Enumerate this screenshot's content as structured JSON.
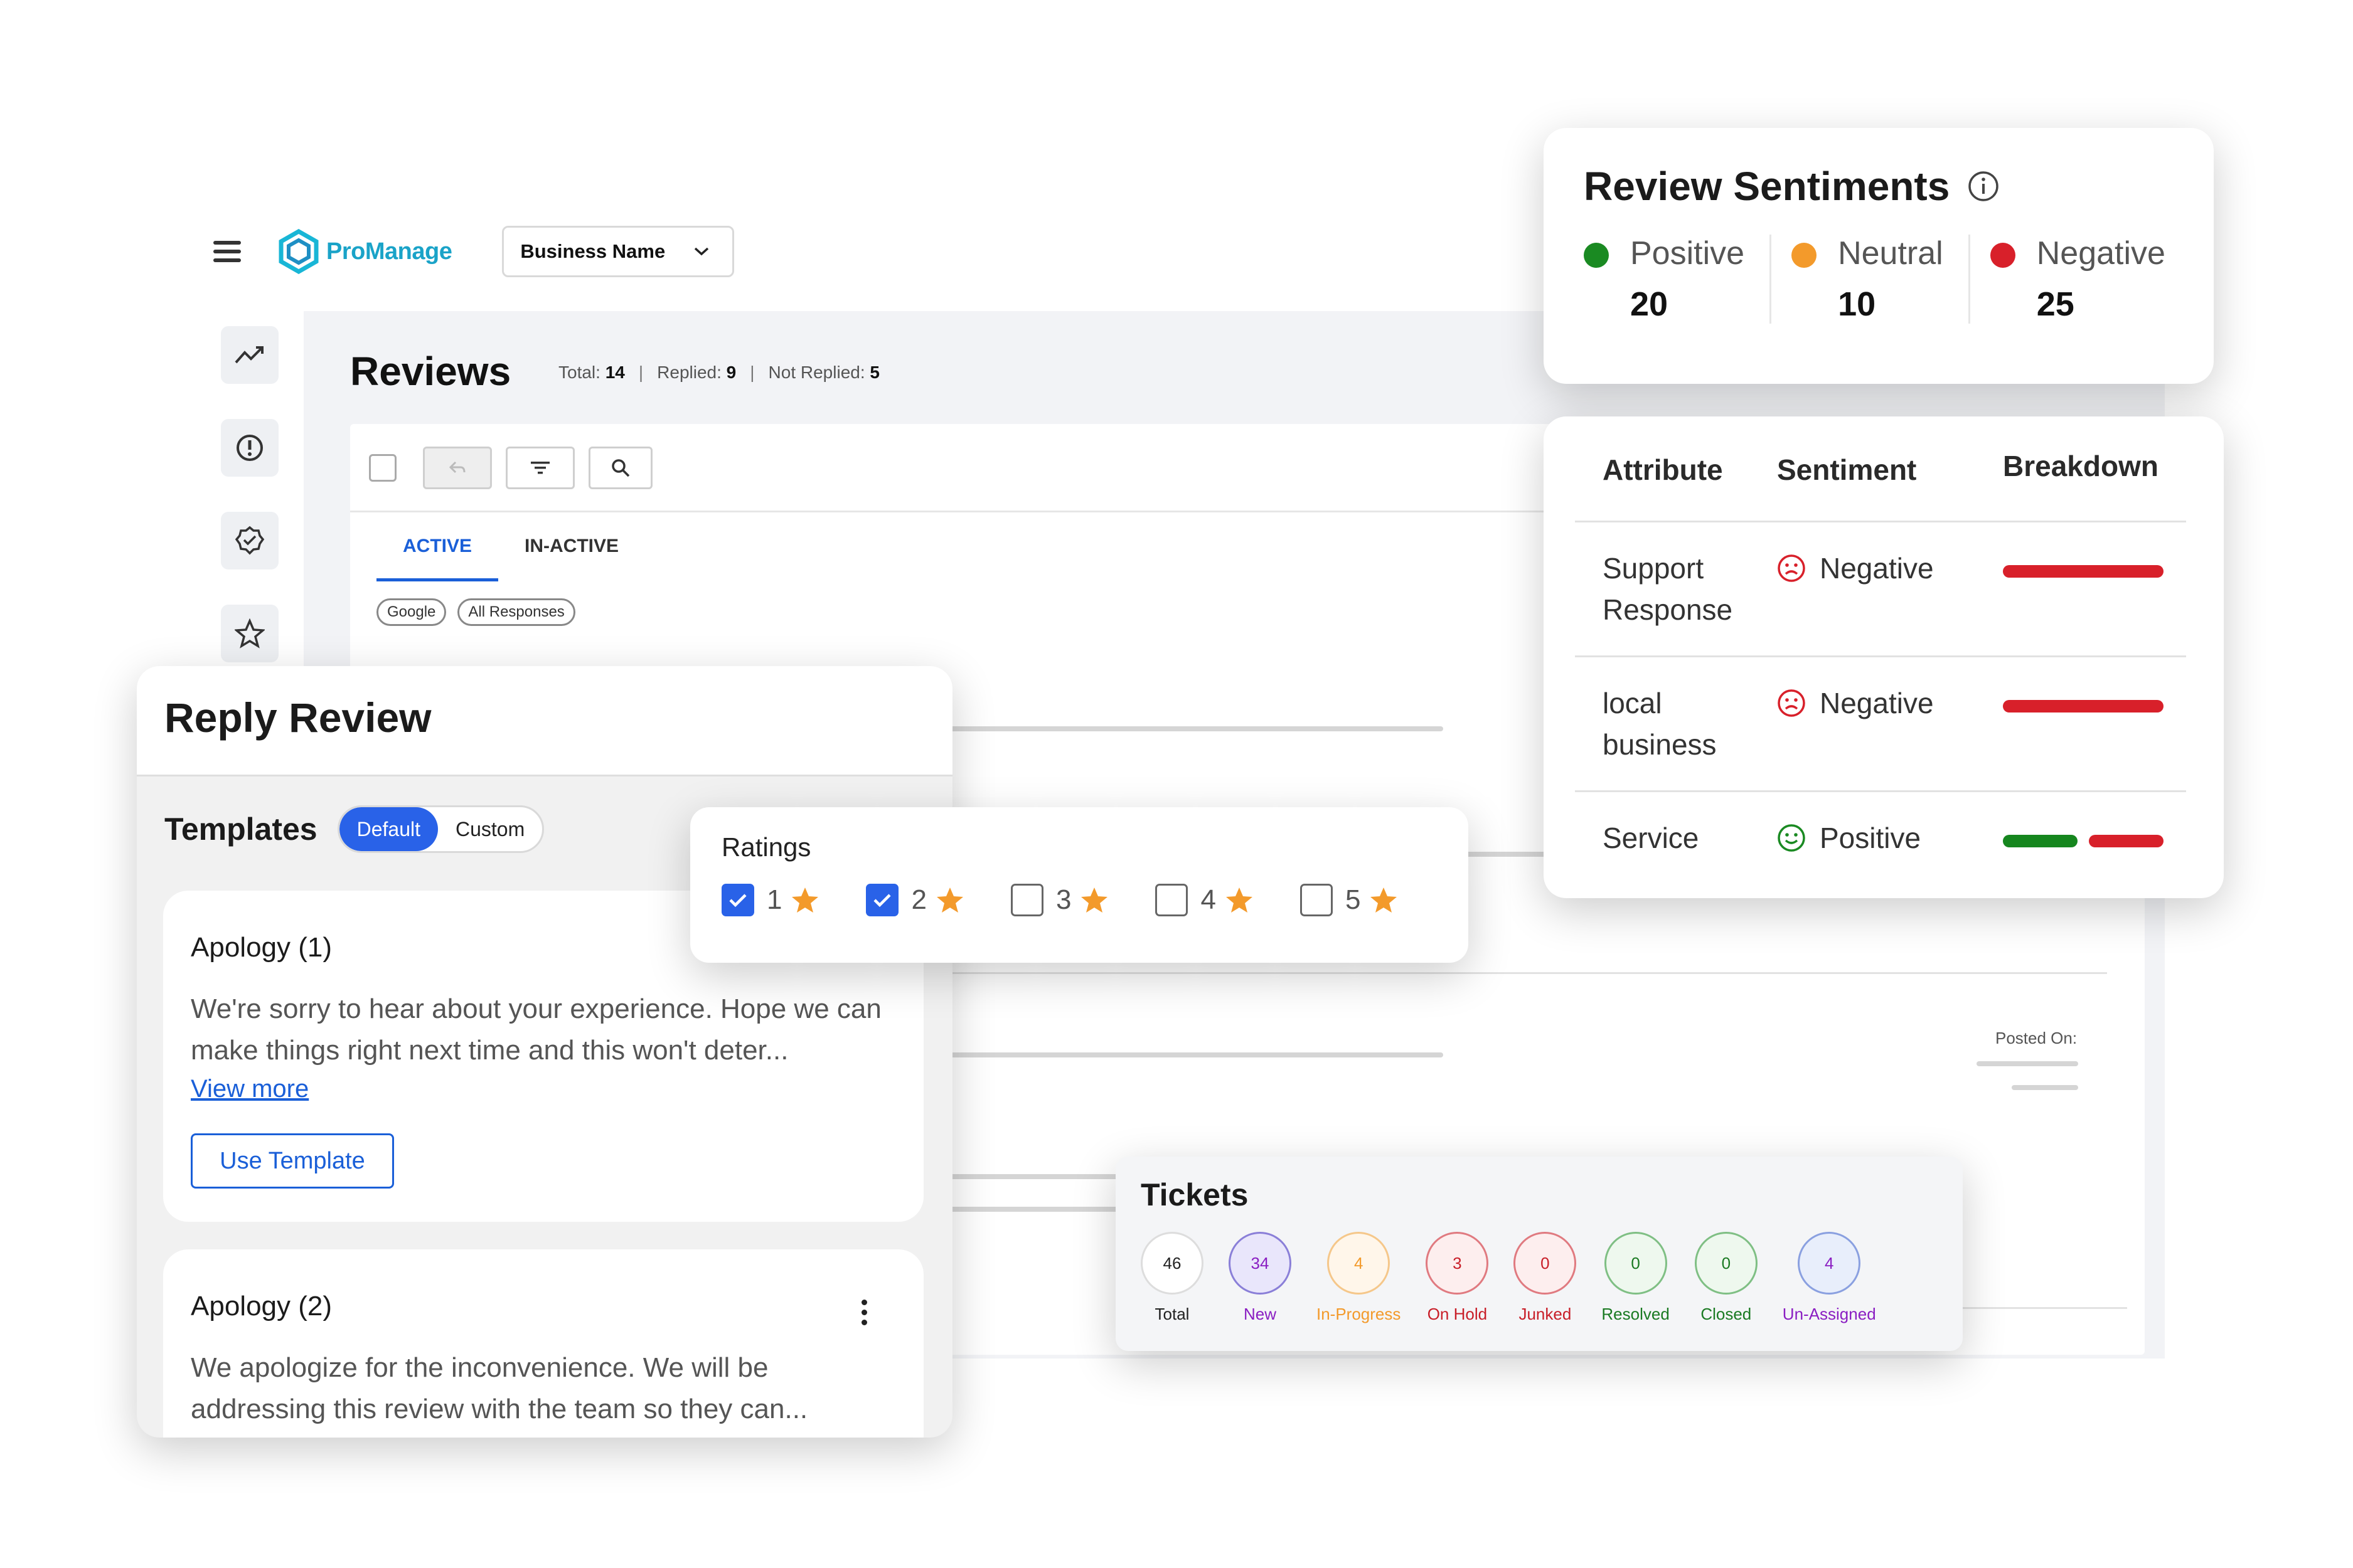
{
  "header": {
    "brand": "ProManage",
    "business_select": "Business Name"
  },
  "reviews": {
    "title": "Reviews",
    "stats": [
      {
        "label": "Total:",
        "value": "14"
      },
      {
        "label": "Replied:",
        "value": "9"
      },
      {
        "label": "Not Replied:",
        "value": "5"
      }
    ],
    "tabs": [
      "ACTIVE",
      "IN-ACTIVE"
    ],
    "chips": [
      "Google",
      "All Responses"
    ],
    "posted_on": "Posted On:"
  },
  "reply": {
    "title": "Reply Review",
    "templates_label": "Templates",
    "seg_default": "Default",
    "seg_custom": "Custom",
    "items": [
      {
        "name": "Apology (1)",
        "body": "We're sorry to hear about your experience. Hope we can make things right next time and this won't deter...",
        "link": "View more",
        "button": "Use Template"
      },
      {
        "name": "Apology (2)",
        "body": "We apologize for the inconvenience. We will be addressing this review with the team so they can..."
      }
    ]
  },
  "ratings": {
    "title": "Ratings",
    "items": [
      {
        "label": "1",
        "checked": true
      },
      {
        "label": "2",
        "checked": true
      },
      {
        "label": "3",
        "checked": false
      },
      {
        "label": "4",
        "checked": false
      },
      {
        "label": "5",
        "checked": false
      }
    ]
  },
  "sentiments": {
    "title": "Review Sentiments",
    "items": [
      {
        "label": "Positive",
        "value": "20",
        "color": "#1a8a22"
      },
      {
        "label": "Neutral",
        "value": "10",
        "color": "#f39a2b"
      },
      {
        "label": "Negative",
        "value": "25",
        "color": "#d8202a"
      }
    ]
  },
  "attributes": {
    "headers": [
      "Attribute",
      "Sentiment",
      "Breakdown"
    ],
    "rows": [
      {
        "attribute": "Support Response",
        "sentiment": "Negative",
        "positive_share": 0,
        "negative_share": 1
      },
      {
        "attribute": "local business",
        "sentiment": "Negative",
        "positive_share": 0,
        "negative_share": 1
      },
      {
        "attribute": "Service",
        "sentiment": "Positive",
        "positive_share": 0.5,
        "negative_share": 0.5
      }
    ]
  },
  "tickets": {
    "title": "Tickets",
    "items": [
      {
        "label": "Total",
        "value": "46",
        "color": "#222222",
        "border": "#dddddd",
        "fill": "#ffffff"
      },
      {
        "label": "New",
        "value": "34",
        "color": "#8a1ec2",
        "border": "#8a7fd8",
        "fill": "#e9e6fb"
      },
      {
        "label": "In-Progress",
        "value": "4",
        "color": "#f39a2b",
        "border": "#f5c78a",
        "fill": "#fff6ea"
      },
      {
        "label": "On Hold",
        "value": "3",
        "color": "#c81e28",
        "border": "#e07a80",
        "fill": "#fdeeee"
      },
      {
        "label": "Junked",
        "value": "0",
        "color": "#c81e28",
        "border": "#e07a80",
        "fill": "#fdeeee"
      },
      {
        "label": "Resolved",
        "value": "0",
        "color": "#1a7a22",
        "border": "#7fbf84",
        "fill": "#eef8ee"
      },
      {
        "label": "Closed",
        "value": "0",
        "color": "#1a7a22",
        "border": "#7fbf84",
        "fill": "#eef8ee"
      },
      {
        "label": "Un-Assigned",
        "value": "4",
        "color": "#8a1ec2",
        "border": "#8aa0e0",
        "fill": "#e8eefb"
      }
    ]
  }
}
